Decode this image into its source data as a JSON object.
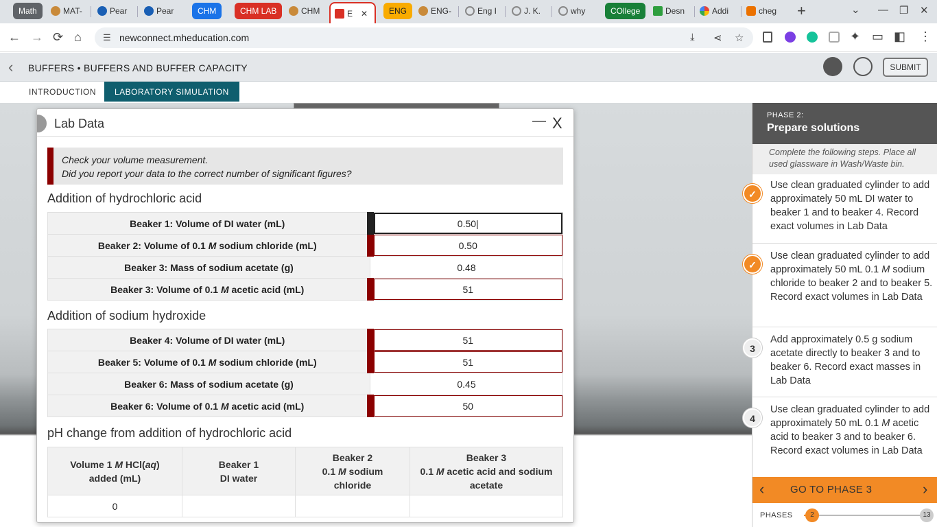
{
  "browser": {
    "tabs": [
      {
        "label": "Math",
        "kind": "group",
        "color": "#5f6368"
      },
      {
        "label": "MAT-",
        "kind": "tab"
      },
      {
        "label": "Pear",
        "kind": "tab"
      },
      {
        "label": "Pear",
        "kind": "tab"
      },
      {
        "label": "CHM",
        "kind": "group",
        "color": "#1a73e8"
      },
      {
        "label": "CHM LAB",
        "kind": "group",
        "color": "#d93025"
      },
      {
        "label": "CHM",
        "kind": "tab"
      },
      {
        "label": "E",
        "kind": "tab-active"
      },
      {
        "label": "ENG",
        "kind": "group",
        "color": "#f9ab00"
      },
      {
        "label": "ENG-",
        "kind": "tab"
      },
      {
        "label": "Eng I",
        "kind": "tab"
      },
      {
        "label": "J. K.",
        "kind": "tab"
      },
      {
        "label": "why",
        "kind": "tab"
      },
      {
        "label": "COllege",
        "kind": "group",
        "color": "#188038"
      },
      {
        "label": "Desn",
        "kind": "tab"
      },
      {
        "label": "Addi",
        "kind": "tab"
      },
      {
        "label": "cheg",
        "kind": "tab"
      }
    ],
    "url": "newconnect.mheducation.com",
    "tab_close": "✕",
    "new_tab": "+"
  },
  "app": {
    "title": "BUFFERS • BUFFERS AND BUFFER CAPACITY",
    "submit": "SUBMIT",
    "tabs": {
      "intro": "INTRODUCTION",
      "sim": "LABORATORY SIMULATION"
    }
  },
  "lab_data": {
    "title": "Lab Data",
    "minimize": "—",
    "close": "X",
    "feedback_line1": "Check your volume measurement.",
    "feedback_line2": "Did you report your data to the correct number of significant figures?",
    "hcl_section": "Addition of hydrochloric acid",
    "naoh_section": "Addition of sodium hydroxide",
    "ph_section": "pH change from addition of hydrochloric acid",
    "hcl_rows": [
      {
        "pre": "Beaker 1: Volume of DI water (mL)",
        "m": "",
        "post": "",
        "value": "0.50",
        "state": "focus"
      },
      {
        "pre": "Beaker 2: Volume of 0.1 ",
        "m": "M",
        "post": " sodium chloride (mL)",
        "value": "0.50",
        "state": "error"
      },
      {
        "pre": "Beaker 3: Mass of sodium acetate (g)",
        "m": "",
        "post": "",
        "value": "0.48",
        "state": "ok"
      },
      {
        "pre": "Beaker 3: Volume of 0.1 ",
        "m": "M",
        "post": " acetic acid (mL)",
        "value": "51",
        "state": "error"
      }
    ],
    "naoh_rows": [
      {
        "pre": "Beaker 4: Volume of DI water (mL)",
        "m": "",
        "post": "",
        "value": "51",
        "state": "error"
      },
      {
        "pre": "Beaker 5: Volume of 0.1 ",
        "m": "M",
        "post": " sodium chloride (mL)",
        "value": "51",
        "state": "error"
      },
      {
        "pre": "Beaker 6: Mass of sodium acetate (g)",
        "m": "",
        "post": "",
        "value": "0.45",
        "state": "ok"
      },
      {
        "pre": "Beaker 6: Volume of 0.1 ",
        "m": "M",
        "post": " acetic acid (mL)",
        "value": "50",
        "state": "error"
      }
    ],
    "ph_headers": {
      "c1a": "Volume 1 ",
      "c1m": "M",
      "c1b": " HCl(",
      "c1aq": "aq",
      "c1c": ")",
      "c1d": "added (mL)",
      "c2a": "Beaker 1",
      "c2b": "DI water",
      "c3a": "Beaker 2",
      "c3b": "0.1 ",
      "c3m": "M",
      "c3c": " sodium",
      "c3d": "chloride",
      "c4a": "Beaker 3",
      "c4b": "0.1 ",
      "c4m": "M",
      "c4c": " acetic acid and sodium",
      "c4d": "acetate"
    },
    "ph_first_row": "0"
  },
  "phase": {
    "label": "PHASE 2:",
    "title": "Prepare solutions",
    "instructions": "Complete the following steps. Place all used glassware in Wash/Waste bin.",
    "steps": [
      {
        "badge": "✓",
        "done": true,
        "pre": "Use clean graduated cylinder to add approximately 50 mL DI water to beaker 1 and to beaker 4. Record exact volumes in Lab Data",
        "m": "",
        "post": ""
      },
      {
        "badge": "✓",
        "done": true,
        "pre": "Use clean graduated cylinder to add approximately 50 mL 0.1 ",
        "m": "M",
        "post": " sodium chloride to beaker 2 and to beaker 5. Record exact volumes in Lab Data"
      },
      {
        "badge": "3",
        "done": false,
        "pre": "Add approximately 0.5 g sodium acetate directly to beaker 3 and to beaker 6. Record exact masses in Lab Data",
        "m": "",
        "post": ""
      },
      {
        "badge": "4",
        "done": false,
        "pre": "Use clean graduated cylinder to add approximately 50 mL 0.1 ",
        "m": "M",
        "post": " acetic acid to beaker 3 and to beaker 6. Record exact volumes in Lab Data"
      }
    ],
    "next_label": "GO TO PHASE 3",
    "phases_label": "PHASES",
    "current_phase": "2",
    "total_phases": "13"
  },
  "colors": {
    "accent": "#f28a25",
    "error": "#8b0000",
    "teal": "#0f5e6e"
  }
}
